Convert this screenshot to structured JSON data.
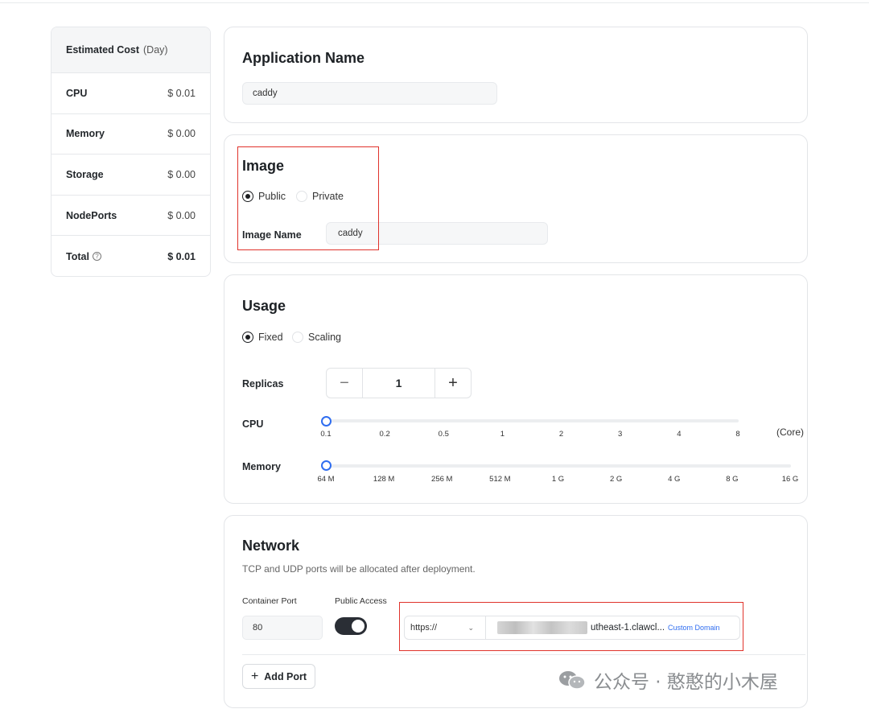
{
  "cost": {
    "title": "Estimated Cost",
    "unit": "(Day)",
    "rows": [
      {
        "label": "CPU",
        "value": "$ 0.01"
      },
      {
        "label": "Memory",
        "value": "$ 0.00"
      },
      {
        "label": "Storage",
        "value": "$ 0.00"
      },
      {
        "label": "NodePorts",
        "value": "$ 0.00"
      },
      {
        "label": "Total",
        "value": "$ 0.01",
        "icon": "help-circle-icon"
      }
    ]
  },
  "app_name": {
    "title": "Application Name",
    "value": "caddy"
  },
  "image": {
    "title": "Image",
    "options": [
      {
        "label": "Public",
        "selected": true
      },
      {
        "label": "Private",
        "selected": false
      }
    ],
    "name_label": "Image Name",
    "name_value": "caddy"
  },
  "usage": {
    "title": "Usage",
    "options": [
      {
        "label": "Fixed",
        "selected": true
      },
      {
        "label": "Scaling",
        "selected": false
      }
    ],
    "replicas_label": "Replicas",
    "replicas_value": "1",
    "minus": "−",
    "plus": "+",
    "cpu_label": "CPU",
    "cpu_ticks": [
      "0.1",
      "0.2",
      "0.5",
      "1",
      "2",
      "3",
      "4",
      "8"
    ],
    "cpu_unit": "(Core)",
    "cpu_value": "0.1",
    "memory_label": "Memory",
    "memory_ticks": [
      "64 M",
      "128 M",
      "256 M",
      "512 M",
      "1 G",
      "2 G",
      "4 G",
      "8 G",
      "16 G"
    ],
    "memory_value": "64 M"
  },
  "network": {
    "title": "Network",
    "subtitle": "TCP and UDP ports will be allocated after deployment.",
    "port_label": "Container Port",
    "port_value": "80",
    "public_label": "Public Access",
    "public_on": true,
    "protocol": "https://",
    "domain_prefix": "",
    "domain_visible": "utheast-1.clawcl...",
    "custom_domain": "Custom Domain",
    "add_port": "Add Port"
  },
  "watermark": {
    "text": "公众号 · 憨憨的小木屋",
    "icon": "wechat-icon"
  },
  "colors": {
    "accent": "#2f6df0",
    "highlight": "#e0322b",
    "toggle": "#2a2e35"
  }
}
